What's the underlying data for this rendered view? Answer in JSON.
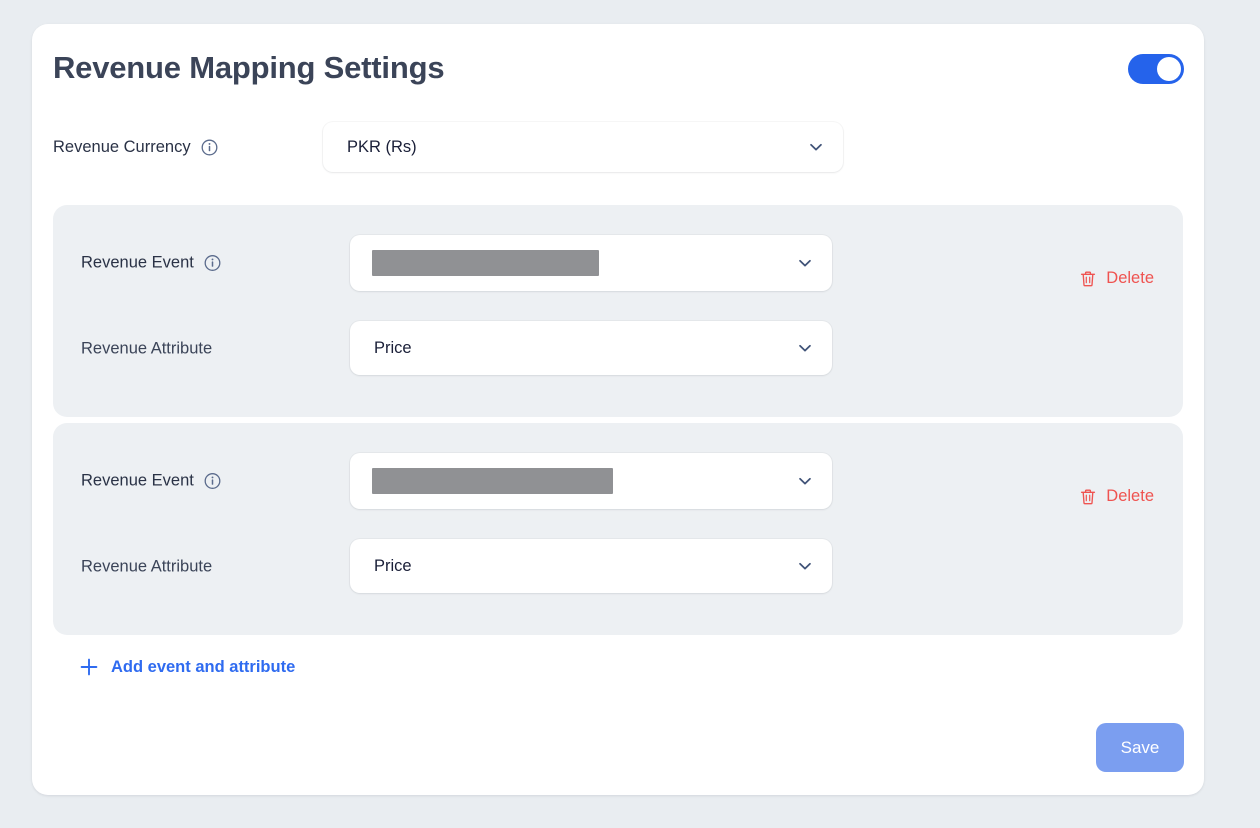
{
  "header": {
    "title": "Revenue Mapping Settings",
    "toggle": {
      "name": "enable-revenue-mapping",
      "state": "on"
    }
  },
  "currency": {
    "label": "Revenue Currency",
    "info_icon": "info-icon",
    "selected": "PKR (Rs)",
    "chevron_icon": "chevron-down-icon"
  },
  "event_cards": [
    {
      "event_label": "Revenue Event",
      "event_info_icon": "info-icon",
      "event_value": "",
      "event_value_redacted": true,
      "attribute_label": "Revenue Attribute",
      "attribute_value": "Price",
      "delete_label": "Delete",
      "delete_icon": "trash-icon"
    },
    {
      "event_label": "Revenue Event",
      "event_info_icon": "info-icon",
      "event_value": "",
      "event_value_redacted": true,
      "attribute_label": "Revenue Attribute",
      "attribute_value": "Price",
      "delete_label": "Delete",
      "delete_icon": "trash-icon"
    }
  ],
  "add_action": {
    "label": "Add event and attribute",
    "icon": "plus-icon"
  },
  "footer": {
    "save_label": "Save"
  },
  "colors": {
    "page_background": "#e9edf1",
    "panel_background": "#ffffff",
    "card_background": "#edf0f3",
    "title_text": "#3b4458",
    "body_text": "#2a3246",
    "value_text": "#1a1f38",
    "toggle_on": "#2563eb",
    "delete_red": "#ef5350",
    "link_blue": "#2f6bf0",
    "save_blue": "#7b9ef0",
    "redacted_gray": "#909194",
    "chevron": "#3f5277"
  }
}
